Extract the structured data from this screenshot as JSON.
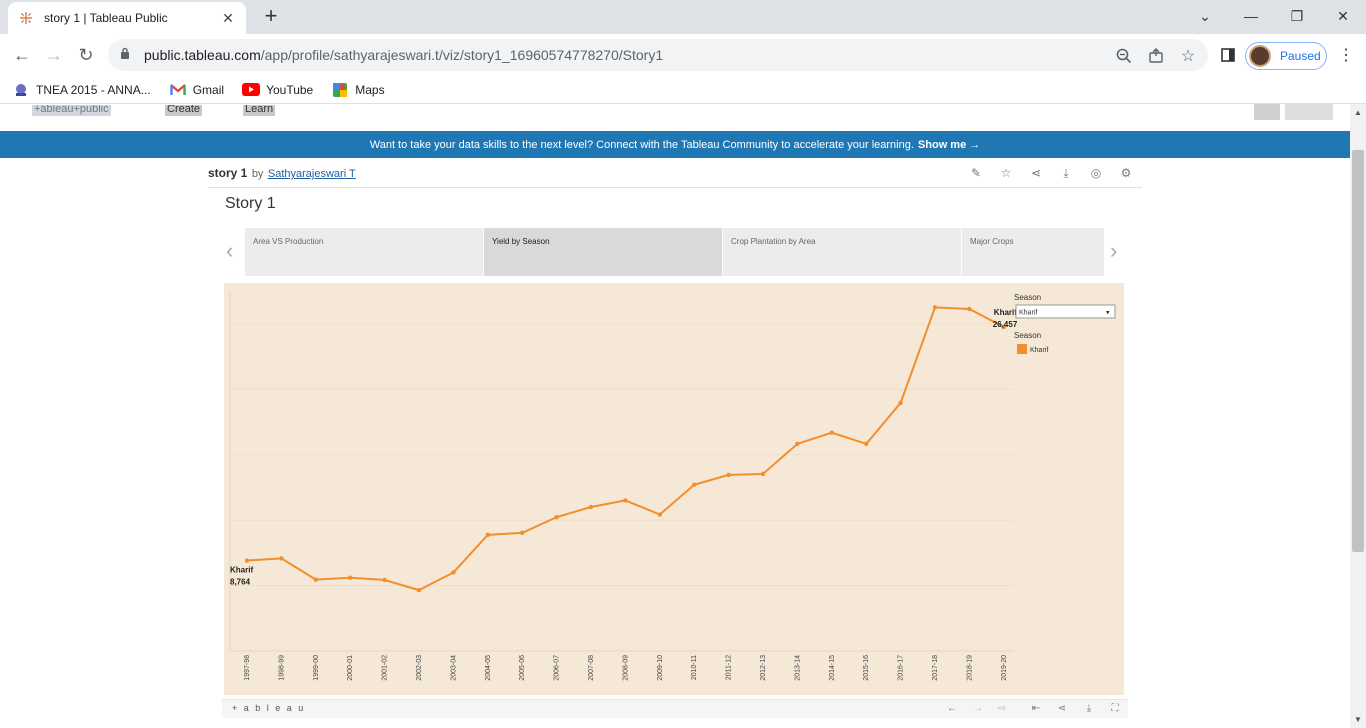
{
  "browser": {
    "tab_title": "story 1 | Tableau Public",
    "url_host": "public.tableau.com",
    "url_path": "/app/profile/sathyarajeswari.t/viz/story1_16960574778270/Story1",
    "profile_label": "Paused",
    "bookmarks": [
      {
        "label": "TNEA 2015 - ANNA...",
        "icon": "tnea-icon"
      },
      {
        "label": "Gmail",
        "icon": "gmail-icon"
      },
      {
        "label": "YouTube",
        "icon": "youtube-icon"
      },
      {
        "label": "Maps",
        "icon": "maps-icon"
      }
    ]
  },
  "site": {
    "logo": "+ableau+public",
    "menu": [
      "Create",
      "Learn"
    ],
    "banner_text": "Want to take your data skills to the next level? Connect with the Tableau Community to accelerate your learning.",
    "banner_link": "Show me →"
  },
  "viz": {
    "name": "story 1",
    "by": "by",
    "author": "Sathyarajeswari T",
    "story_title": "Story 1",
    "story_points": [
      "Area VS Production",
      "Yield by Season",
      "Crop Plantation by Area",
      "Major Crops"
    ],
    "active_point": 1,
    "filter_label": "Season",
    "filter_value": "Kharif",
    "legend_title": "Season",
    "legend_item": "Kharif",
    "brand": "+ a b l e a u"
  },
  "chart_data": {
    "type": "line",
    "title": "",
    "xlabel": "",
    "ylabel": "",
    "x": [
      "1997-98",
      "1998-99",
      "1999-00",
      "2000-01",
      "2001-02",
      "2002-03",
      "2003-04",
      "2004-05",
      "2005-06",
      "2006-07",
      "2007-08",
      "2008-09",
      "2009-10",
      "2010-11",
      "2011-12",
      "2012-13",
      "2013-14",
      "2014-15",
      "2015-16",
      "2016-17",
      "2017-18",
      "2018-19",
      "2019-20"
    ],
    "series": [
      {
        "name": "Kharif",
        "color": "#f28e2b",
        "values": [
          8764,
          8830,
          8180,
          8240,
          8170,
          7860,
          8400,
          9550,
          9610,
          10090,
          10400,
          10600,
          10170,
          11080,
          11380,
          11410,
          12330,
          12670,
          12330,
          13580,
          16500,
          16450,
          15900
        ]
      }
    ],
    "annotations": [
      {
        "index": 0,
        "series": "Kharif",
        "text": "Kharif",
        "value_text": "8,764"
      },
      {
        "index": 22,
        "series": "Kharif",
        "text": "Kharif",
        "value_text": "26,457"
      }
    ],
    "ylim": [
      6000,
      17000
    ],
    "grid": true,
    "legend": "top-right"
  }
}
